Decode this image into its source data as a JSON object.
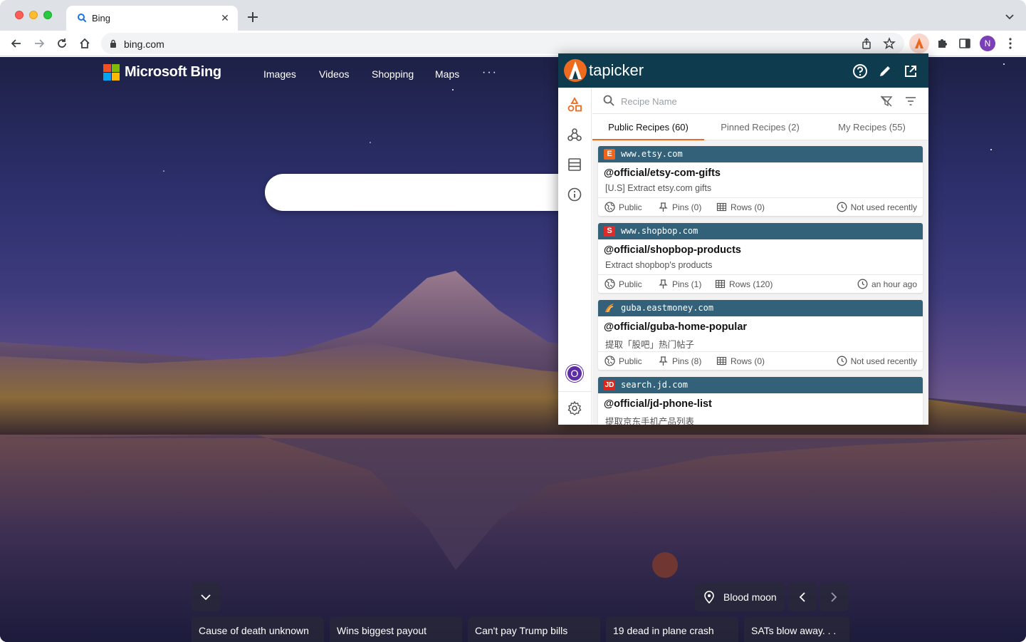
{
  "browser": {
    "tab_title": "Bing",
    "url": "bing.com",
    "profile_initial": "N"
  },
  "bing": {
    "brand": "Microsoft Bing",
    "nav": [
      "Images",
      "Videos",
      "Shopping",
      "Maps"
    ],
    "more": "···",
    "image_title": "Blood moon",
    "news": [
      "Cause of death unknown",
      "Wins biggest payout",
      "Can't pay Trump bills",
      "19 dead in plane crash",
      "SATs blow away. . ."
    ]
  },
  "tapicker": {
    "name": "tapicker",
    "search_placeholder": "Recipe Name",
    "avatar_initial": "O",
    "tabs": [
      "Public Recipes (60)",
      "Pinned Recipes (2)",
      "My Recipes (55)"
    ],
    "active_tab": 0,
    "accent_color": "#ee6a1f",
    "header_color": "#0e3b4e",
    "card_header_color": "#336179",
    "recipes": [
      {
        "domain": "www.etsy.com",
        "favicon_letter": "E",
        "favicon_color": "#f1641e",
        "title": "@official/etsy-com-gifts",
        "description": "[U.S] Extract etsy.com gifts",
        "visibility": "Public",
        "pins": "Pins (0)",
        "rows": "Rows (0)",
        "last_used": "Not used recently"
      },
      {
        "domain": "www.shopbop.com",
        "favicon_letter": "S",
        "favicon_color": "#e02b2b",
        "title": "@official/shopbop-products",
        "description": "Extract shopbop's products",
        "visibility": "Public",
        "pins": "Pins (1)",
        "rows": "Rows (120)",
        "last_used": "an hour ago"
      },
      {
        "domain": "guba.eastmoney.com",
        "favicon_letter": "",
        "favicon_color": "#f28a1e",
        "title": "@official/guba-home-popular",
        "description": "提取「股吧」热门帖子",
        "visibility": "Public",
        "pins": "Pins (8)",
        "rows": "Rows (0)",
        "last_used": "Not used recently"
      },
      {
        "domain": "search.jd.com",
        "favicon_letter": "JD",
        "favicon_color": "#e1251b",
        "title": "@official/jd-phone-list",
        "description": "提取京东手机产品列表",
        "visibility": "",
        "pins": "",
        "rows": "",
        "last_used": ""
      }
    ]
  }
}
